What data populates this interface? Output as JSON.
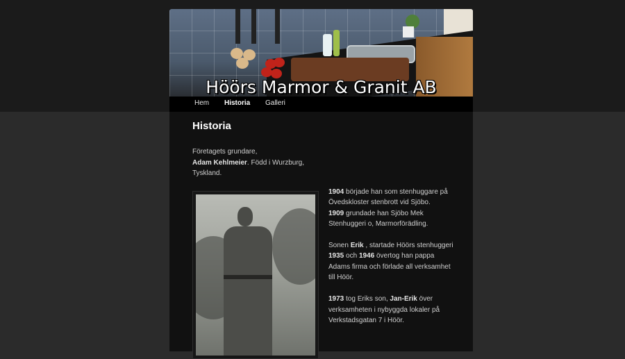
{
  "site": {
    "title": "Höörs Marmor & Granit AB"
  },
  "nav": {
    "items": [
      {
        "label": "Hem"
      },
      {
        "label": "Historia"
      },
      {
        "label": "Galleri"
      }
    ],
    "active": "Historia"
  },
  "main": {
    "heading": "Historia",
    "intro": {
      "line1": "Företagets grundare,",
      "name": "Adam Kehlmeier",
      "rest": ". Född i Wurzburg, Tyskland."
    },
    "paragraphs": {
      "p1": {
        "year1": "1904",
        "text1": " började han som stenhuggare på Övedskloster stenbrott vid Sjöbo.",
        "year2": "1909",
        "text2": " grundade han Sjöbo Mek Stenhuggeri o, Marmorförädling."
      },
      "p2": {
        "text1": "Sonen ",
        "name": "Erik",
        "text2": " , startade Höörs stenhuggeri ",
        "year1": "1935",
        "text3": " och ",
        "year2": "1946",
        "text4": " övertog han pappa Adams firma och förlade all verksamhet till Höör."
      },
      "p3": {
        "year": "1973",
        "text1": " tog Eriks son, ",
        "name": "Jan-Erik",
        "text2": " över verksamheten i nybyggda lokaler på Verkstadsgatan 7 i Höör."
      }
    }
  },
  "icons": {
    "header_image": "kitchen-countertop-photo",
    "portrait": "historic-soldier-portrait-photo"
  },
  "colors": {
    "page_bg": "#2b2b2b",
    "content_bg": "#111111",
    "nav_bg": "#000000",
    "text": "#cfcfcf",
    "heading": "#ffffff"
  }
}
